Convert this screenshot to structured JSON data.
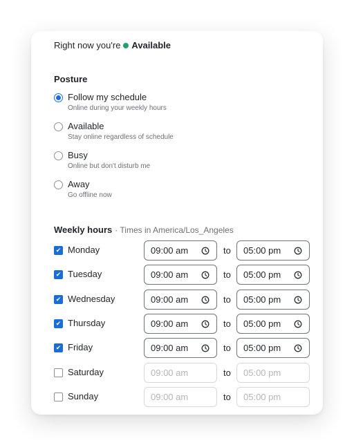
{
  "status": {
    "prefix": "Right now you're",
    "value": "Available",
    "dot_color": "#22a06b"
  },
  "posture": {
    "title": "Posture",
    "options": [
      {
        "label": "Follow my schedule",
        "description": "Online during your weekly hours",
        "selected": true
      },
      {
        "label": "Available",
        "description": "Stay online regardless of schedule",
        "selected": false
      },
      {
        "label": "Busy",
        "description": "Online but don't disturb me",
        "selected": false
      },
      {
        "label": "Away",
        "description": "Go offline now",
        "selected": false
      }
    ]
  },
  "weekly": {
    "title": "Weekly hours",
    "subtitle": "· Times in America/Los_Angeles",
    "to_label": "to",
    "days": [
      {
        "name": "Monday",
        "enabled": true,
        "start": "09:00 am",
        "end": "05:00 pm"
      },
      {
        "name": "Tuesday",
        "enabled": true,
        "start": "09:00 am",
        "end": "05:00 pm"
      },
      {
        "name": "Wednesday",
        "enabled": true,
        "start": "09:00 am",
        "end": "05:00 pm"
      },
      {
        "name": "Thursday",
        "enabled": true,
        "start": "09:00 am",
        "end": "05:00 pm"
      },
      {
        "name": "Friday",
        "enabled": true,
        "start": "09:00 am",
        "end": "05:00 pm"
      },
      {
        "name": "Saturday",
        "enabled": false,
        "start": "09:00 am",
        "end": "05:00 pm"
      },
      {
        "name": "Sunday",
        "enabled": false,
        "start": "09:00 am",
        "end": "05:00 pm"
      }
    ]
  },
  "icons": {
    "time_input": "clock-icon",
    "enabled_checkbox": "checkmark-icon"
  },
  "colors": {
    "accent": "#1a6dd8",
    "available": "#22a06b"
  }
}
